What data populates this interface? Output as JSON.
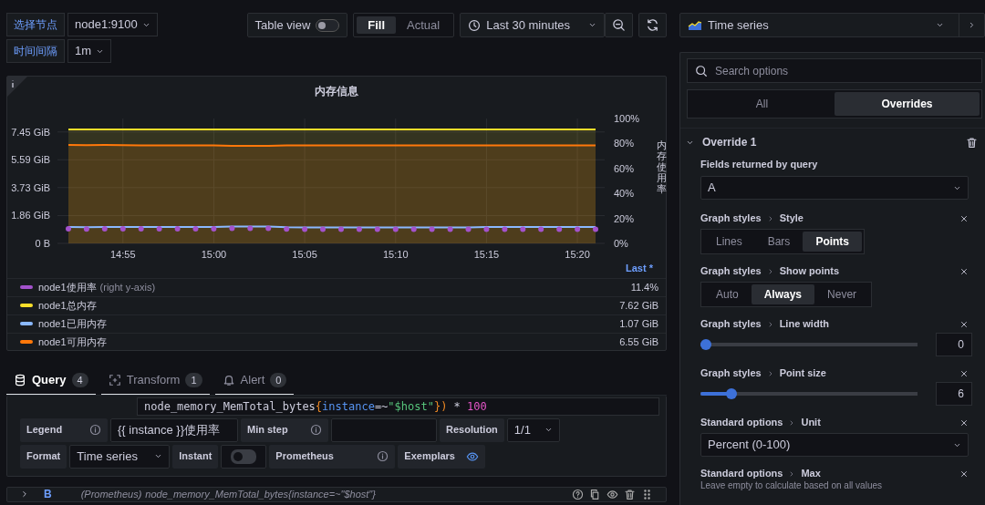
{
  "variables": [
    {
      "label": "选择节点",
      "value": "node1:9100"
    },
    {
      "label": "时间间隔",
      "value": "1m"
    }
  ],
  "toolbar": {
    "table_view": {
      "label": "Table view",
      "on": false
    },
    "size_modes": [
      {
        "label": "Fill",
        "selected": true
      },
      {
        "label": "Actual",
        "selected": false
      }
    ],
    "time_range": "Last 30 minutes"
  },
  "panel": {
    "title": "内存信息",
    "chart_data": {
      "type": "line",
      "y2label": "内存使用率",
      "grid": true,
      "categories": [
        null,
        null,
        null,
        "14:55",
        null,
        null,
        null,
        null,
        "15:00",
        null,
        null,
        null,
        null,
        "15:05",
        null,
        null,
        null,
        null,
        "15:10",
        null,
        null,
        null,
        null,
        "15:15",
        null,
        null,
        null,
        null,
        "15:20",
        null
      ],
      "ylim": [
        0,
        8.35
      ],
      "y2lim": [
        0,
        100
      ],
      "yticks": [
        {
          "value": 0,
          "label": "0 B"
        },
        {
          "value": 1.86,
          "label": "1.86 GiB"
        },
        {
          "value": 3.73,
          "label": "3.73 GiB"
        },
        {
          "value": 5.59,
          "label": "5.59 GiB"
        },
        {
          "value": 7.45,
          "label": "7.45 GiB"
        }
      ],
      "y2ticks": [
        {
          "value": 0,
          "label": "0%"
        },
        {
          "value": 20,
          "label": "20%"
        },
        {
          "value": 40,
          "label": "40%"
        },
        {
          "value": 60,
          "label": "60%"
        },
        {
          "value": 80,
          "label": "80%"
        },
        {
          "value": 100,
          "label": "100%"
        }
      ],
      "series": [
        {
          "name": "node1使用率",
          "color": "#a352cc",
          "axis": "y2",
          "type": "scatter",
          "values": [
            11.6,
            11.5,
            11.6,
            11.6,
            11.6,
            11.6,
            11.6,
            11.6,
            11.6,
            12.1,
            12.1,
            12,
            11.5,
            11.4,
            11.4,
            11.4,
            11.4,
            11.4,
            11.4,
            11.4,
            11.4,
            11.4,
            11.4,
            11.4,
            11.4,
            11.4,
            11.4,
            11.4,
            11.4,
            11.4
          ]
        },
        {
          "name": "node1总内存",
          "color": "#fade2a",
          "type": "area",
          "values": [
            7.62,
            7.62,
            7.62,
            7.62,
            7.62,
            7.62,
            7.62,
            7.62,
            7.62,
            7.62,
            7.62,
            7.62,
            7.62,
            7.62,
            7.62,
            7.62,
            7.62,
            7.62,
            7.62,
            7.62,
            7.62,
            7.62,
            7.62,
            7.62,
            7.62,
            7.62,
            7.62,
            7.62,
            7.62,
            7.62
          ]
        },
        {
          "name": "node1已用内存",
          "color": "#8ab8ff",
          "type": "line",
          "values": [
            1.09,
            1.08,
            1.09,
            1.09,
            1.09,
            1.09,
            1.09,
            1.09,
            1.09,
            1.13,
            1.13,
            1.12,
            1.08,
            1.07,
            1.07,
            1.07,
            1.07,
            1.07,
            1.07,
            1.07,
            1.07,
            1.07,
            1.07,
            1.09,
            1.09,
            1.09,
            1.09,
            1.09,
            1.09,
            1.09
          ]
        },
        {
          "name": "node1可用内存",
          "color": "#ff780a",
          "type": "area",
          "values": [
            6.58,
            6.57,
            6.58,
            6.57,
            6.56,
            6.56,
            6.56,
            6.56,
            6.56,
            6.53,
            6.52,
            6.52,
            6.55,
            6.56,
            6.56,
            6.56,
            6.56,
            6.56,
            6.56,
            6.56,
            6.56,
            6.56,
            6.56,
            6.56,
            6.55,
            6.55,
            6.55,
            6.55,
            6.55,
            6.55
          ]
        }
      ]
    },
    "legend_header": "Last *",
    "legend": [
      {
        "note": "(right y-axis)",
        "value": "11.4%"
      },
      {
        "value": "7.62 GiB"
      },
      {
        "value": "1.07 GiB"
      },
      {
        "value": "6.55 GiB"
      }
    ]
  },
  "query_tabs": [
    {
      "kind": "query",
      "label": "Query",
      "count": "4",
      "selected": true
    },
    {
      "kind": "transform",
      "label": "Transform",
      "count": "1",
      "selected": false
    },
    {
      "kind": "alert",
      "label": "Alert",
      "count": "0",
      "selected": false
    }
  ],
  "query_editor": {
    "code": [
      {
        "kind": "plain",
        "text": "node_memory_MemTotal_bytes"
      },
      {
        "kind": "brace",
        "text": "{"
      },
      {
        "kind": "label",
        "text": "instance"
      },
      {
        "kind": "plain",
        "text": "=~"
      },
      {
        "kind": "string",
        "text": "\"$host\""
      },
      {
        "kind": "brace",
        "text": "})"
      },
      {
        "kind": "plain",
        "text": " * "
      },
      {
        "kind": "number",
        "text": "100"
      }
    ],
    "option_rows": [
      [
        {
          "kind": "info-label",
          "text": "Legend"
        },
        {
          "kind": "input",
          "value": "{{ instance }}使用率"
        },
        {
          "kind": "info-label",
          "text": "Min step"
        },
        {
          "kind": "input"
        },
        {
          "kind": "label",
          "text": "Resolution"
        },
        {
          "kind": "select",
          "value": "1/1"
        }
      ],
      [
        {
          "kind": "label",
          "text": "Format"
        },
        {
          "kind": "select",
          "value": "Time series"
        },
        {
          "kind": "label",
          "text": "Instant"
        },
        {
          "kind": "toggle",
          "on": false
        },
        {
          "kind": "info-label",
          "text": "Prometheus"
        },
        {
          "kind": "eye-label",
          "text": "Exemplars"
        }
      ]
    ],
    "next_query": {
      "ref": "B",
      "source": "(Prometheus)",
      "expr": "node_memory_MemTotal_bytes{instance=~\"$host\"}",
      "expanded": false
    }
  },
  "viz_picker": {
    "label": "Time series"
  },
  "options_pane": {
    "search_placeholder": "Search options",
    "tabs": [
      {
        "label": "All",
        "selected": false
      },
      {
        "label": "Overrides",
        "selected": true
      }
    ],
    "override": {
      "title": "Override 1",
      "expanded": true,
      "matcher_label": "Fields returned by query",
      "matcher_value": "A",
      "properties": [
        {
          "kind": "radio",
          "category": "Graph styles",
          "name": "Style",
          "options": [
            {
              "label": "Lines",
              "selected": false
            },
            {
              "label": "Bars",
              "selected": false
            },
            {
              "label": "Points",
              "selected": true
            }
          ]
        },
        {
          "kind": "radio",
          "category": "Graph styles",
          "name": "Show points",
          "options": [
            {
              "label": "Auto",
              "selected": false
            },
            {
              "label": "Always",
              "selected": true
            },
            {
              "label": "Never",
              "selected": false
            }
          ]
        },
        {
          "kind": "slider",
          "category": "Graph styles",
          "name": "Line width",
          "level": 0,
          "value": "0"
        },
        {
          "kind": "slider",
          "category": "Graph styles",
          "name": "Point size",
          "level": 0.125,
          "value": "6"
        },
        {
          "kind": "select",
          "category": "Standard options",
          "name": "Unit",
          "value": "Percent (0-100)"
        },
        {
          "kind": "text",
          "category": "Standard options",
          "name": "Max",
          "description": "Leave empty to calculate based on all values"
        }
      ]
    }
  }
}
